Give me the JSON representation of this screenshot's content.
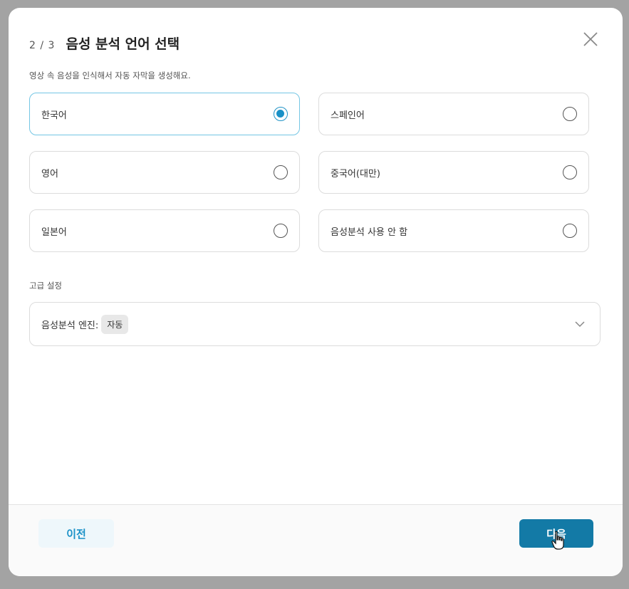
{
  "header": {
    "step": "2 / 3",
    "title": "음성 분석 언어 선택",
    "close_icon": "close-icon"
  },
  "description": "영상 속 음성을 인식해서 자동 자막을 생성해요.",
  "options": [
    {
      "label": "한국어",
      "selected": true
    },
    {
      "label": "스페인어",
      "selected": false
    },
    {
      "label": "영어",
      "selected": false
    },
    {
      "label": "중국어(대만)",
      "selected": false
    },
    {
      "label": "일본어",
      "selected": false
    },
    {
      "label": "음성분석 사용 안 함",
      "selected": false
    }
  ],
  "advanced": {
    "label": "고급 설정",
    "engine_label": "음성분석 엔진:",
    "engine_value": "자동",
    "chevron_icon": "chevron-down-icon"
  },
  "footer": {
    "prev_label": "이전",
    "next_label": "다음"
  },
  "colors": {
    "accent": "#1a91c7",
    "primary_button": "#137aa6",
    "selected_border": "#74c6e4"
  }
}
